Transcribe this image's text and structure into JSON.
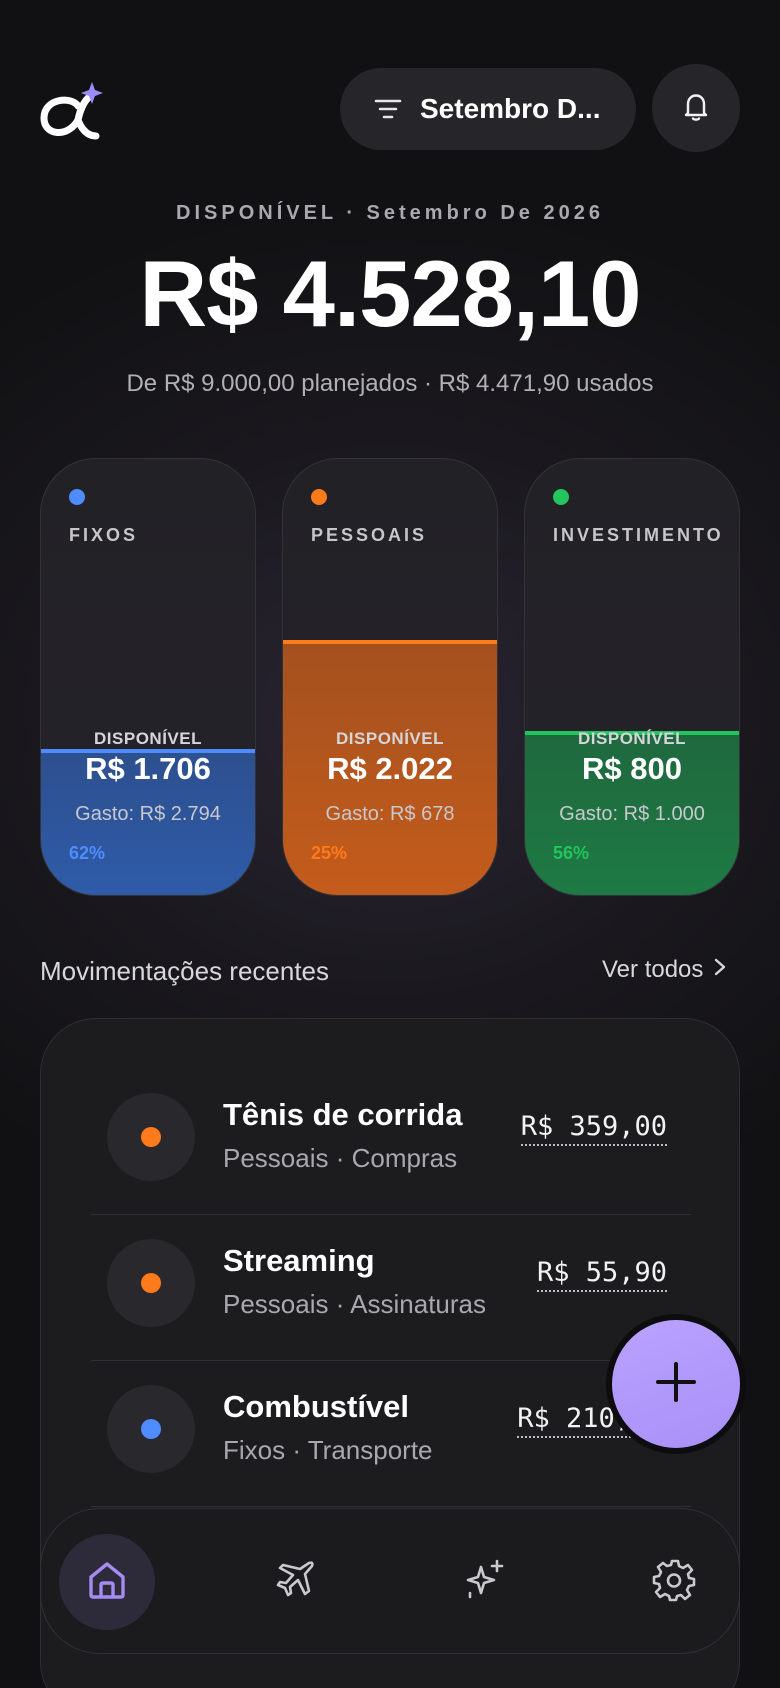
{
  "header": {
    "logo": "alpha-sparkle-logo",
    "filter_label": "Setembro D...",
    "filter_icon": "filter-icon",
    "bell_icon": "bell-icon"
  },
  "summary": {
    "caption": "DISPONÍVEL · Setembro De 2026",
    "amount": "R$ 4.528,10",
    "subtitle": "De R$ 9.000,00 planejados · R$ 4.471,90 usados"
  },
  "budgets": [
    {
      "name": "FIXOS",
      "available_label": "DISPONÍVEL",
      "available": "R$ 1.706",
      "spent": "Gasto: R$ 2.794",
      "percent": "62%",
      "fill_fraction": 0.62,
      "color": "#4f8cff",
      "fill_color": "#2f5ba8"
    },
    {
      "name": "PESSOAIS",
      "available_label": "DISPONÍVEL",
      "available": "R$ 2.022",
      "spent": "Gasto: R$ 678",
      "percent": "25%",
      "fill_fraction": 0.25,
      "color": "#ff7a1a",
      "fill_color": "#c45c1c"
    },
    {
      "name": "INVESTIMENTO",
      "available_label": "DISPONÍVEL",
      "available": "R$ 800",
      "spent": "Gasto: R$ 1.000",
      "percent": "56%",
      "fill_fraction": 0.56,
      "color": "#22c55e",
      "fill_color": "#1e7a44"
    }
  ],
  "recent": {
    "title": "Movimentações recentes",
    "see_all": "Ver todos",
    "items": [
      {
        "title": "Tênis de corrida",
        "meta": "Pessoais · Compras",
        "amount": "R$ 359,00",
        "color": "#ff7a1a"
      },
      {
        "title": "Streaming",
        "meta": "Pessoais · Assinaturas",
        "amount": "R$ 55,90",
        "color": "#ff7a1a"
      },
      {
        "title": "Combustível",
        "meta": "Fixos · Transporte",
        "amount": "R$ 210,",
        "color": "#4f8cff"
      }
    ]
  },
  "fab_icon": "plus-icon",
  "nav": [
    {
      "icon": "home-icon",
      "active": true
    },
    {
      "icon": "airplane-icon",
      "active": false
    },
    {
      "icon": "sparkles-icon",
      "active": false
    },
    {
      "icon": "gear-icon",
      "active": false
    }
  ]
}
